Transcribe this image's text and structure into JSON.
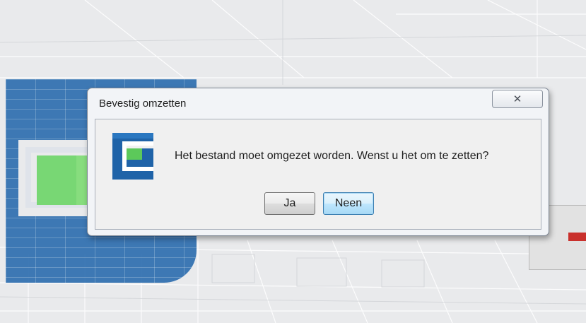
{
  "dialog": {
    "title": "Bevestig omzetten",
    "close_icon": "close-icon",
    "app_icon": "app-logo-icon",
    "message": "Het bestand moet omgezet worden. Wenst u het om te zetten?",
    "buttons": {
      "yes_label": "Ja",
      "no_label": "Neen"
    }
  },
  "colors": {
    "dialog_frame": "#f2f4f7",
    "brand_blue": "#2f6fb0",
    "default_button_border": "#3c7fb1"
  }
}
